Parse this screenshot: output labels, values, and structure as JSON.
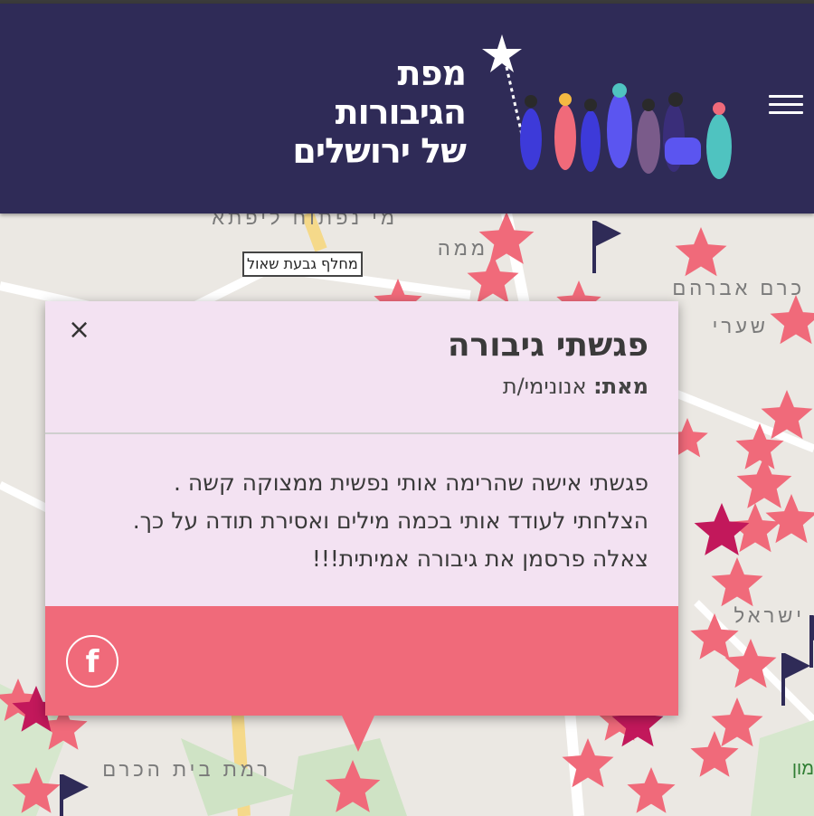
{
  "header": {
    "logo_line1": "מפת",
    "logo_line2": "הגיבורות",
    "logo_line3": "של ירושלים",
    "menu_icon": "hamburger-icon"
  },
  "map": {
    "bus_stop_label": "מחלף גבעת שאול",
    "place_labels": [
      "מי נפתוח ליפתא",
      "ממה",
      "כרם אברהם",
      "רמת בית הכרם",
      "שערי",
      "ישראל",
      "מון"
    ],
    "colors": {
      "star": "#f06a7a",
      "star_dark": "#c2185b",
      "flag": "#2f2b57"
    }
  },
  "popup": {
    "title": "פגשתי גיבורה",
    "from_label": "מאת:",
    "from_value": "אנונימי/ת",
    "body_lines": [
      "פגשתי אישה שהרימה אותי נפשית ממצוקה קשה .",
      "הצלחתי לעודד אותי בכמה מילים ואסירת תודה על כך.",
      "צאלה פרסמן את גיבורה אמיתית!!!"
    ],
    "close_symbol": "×",
    "share_symbol": "f",
    "colors": {
      "background": "#f3e2f2",
      "footer": "#f06a7a"
    }
  }
}
